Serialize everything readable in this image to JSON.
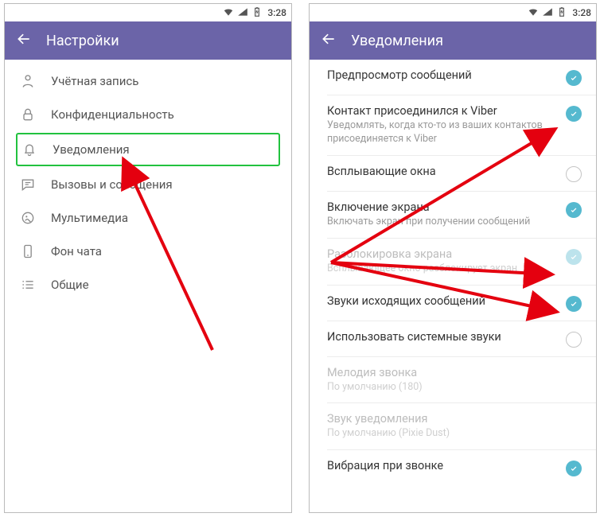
{
  "status": {
    "time": "3:28"
  },
  "left": {
    "title": "Настройки",
    "items": [
      {
        "label": "Учётная запись"
      },
      {
        "label": "Конфиденциальность"
      },
      {
        "label": "Уведомления"
      },
      {
        "label": "Вызовы и сообщения"
      },
      {
        "label": "Мультимедиа"
      },
      {
        "label": "Фон чата"
      },
      {
        "label": "Общие"
      }
    ]
  },
  "right": {
    "title": "Уведомления",
    "rows": {
      "preview": {
        "title": "Предпросмотр сообщений"
      },
      "contact_joined": {
        "title": "Контакт присоединился к Viber",
        "sub": "Уведомлять, когда кто-то из ваших контактов присоединяется к Viber"
      },
      "popup": {
        "title": "Всплывающие окна"
      },
      "screen_on": {
        "title": "Включение экрана",
        "sub": "Включать экран при получении сообщений"
      },
      "unlock": {
        "title": "Разблокировка экрана",
        "sub": "Всплывающее окно разблокирует экран"
      },
      "out_sounds": {
        "title": "Звуки исходящих сообщений"
      },
      "sys_sounds": {
        "title": "Использовать системные звуки"
      },
      "ringtone": {
        "title": "Мелодия звонка",
        "sub": "По умолчанию (180)"
      },
      "notif_sound": {
        "title": "Звук уведомления",
        "sub": "По умолчанию (Pixie Dust)"
      },
      "vibrate": {
        "title": "Вибрация при звонке"
      }
    }
  }
}
